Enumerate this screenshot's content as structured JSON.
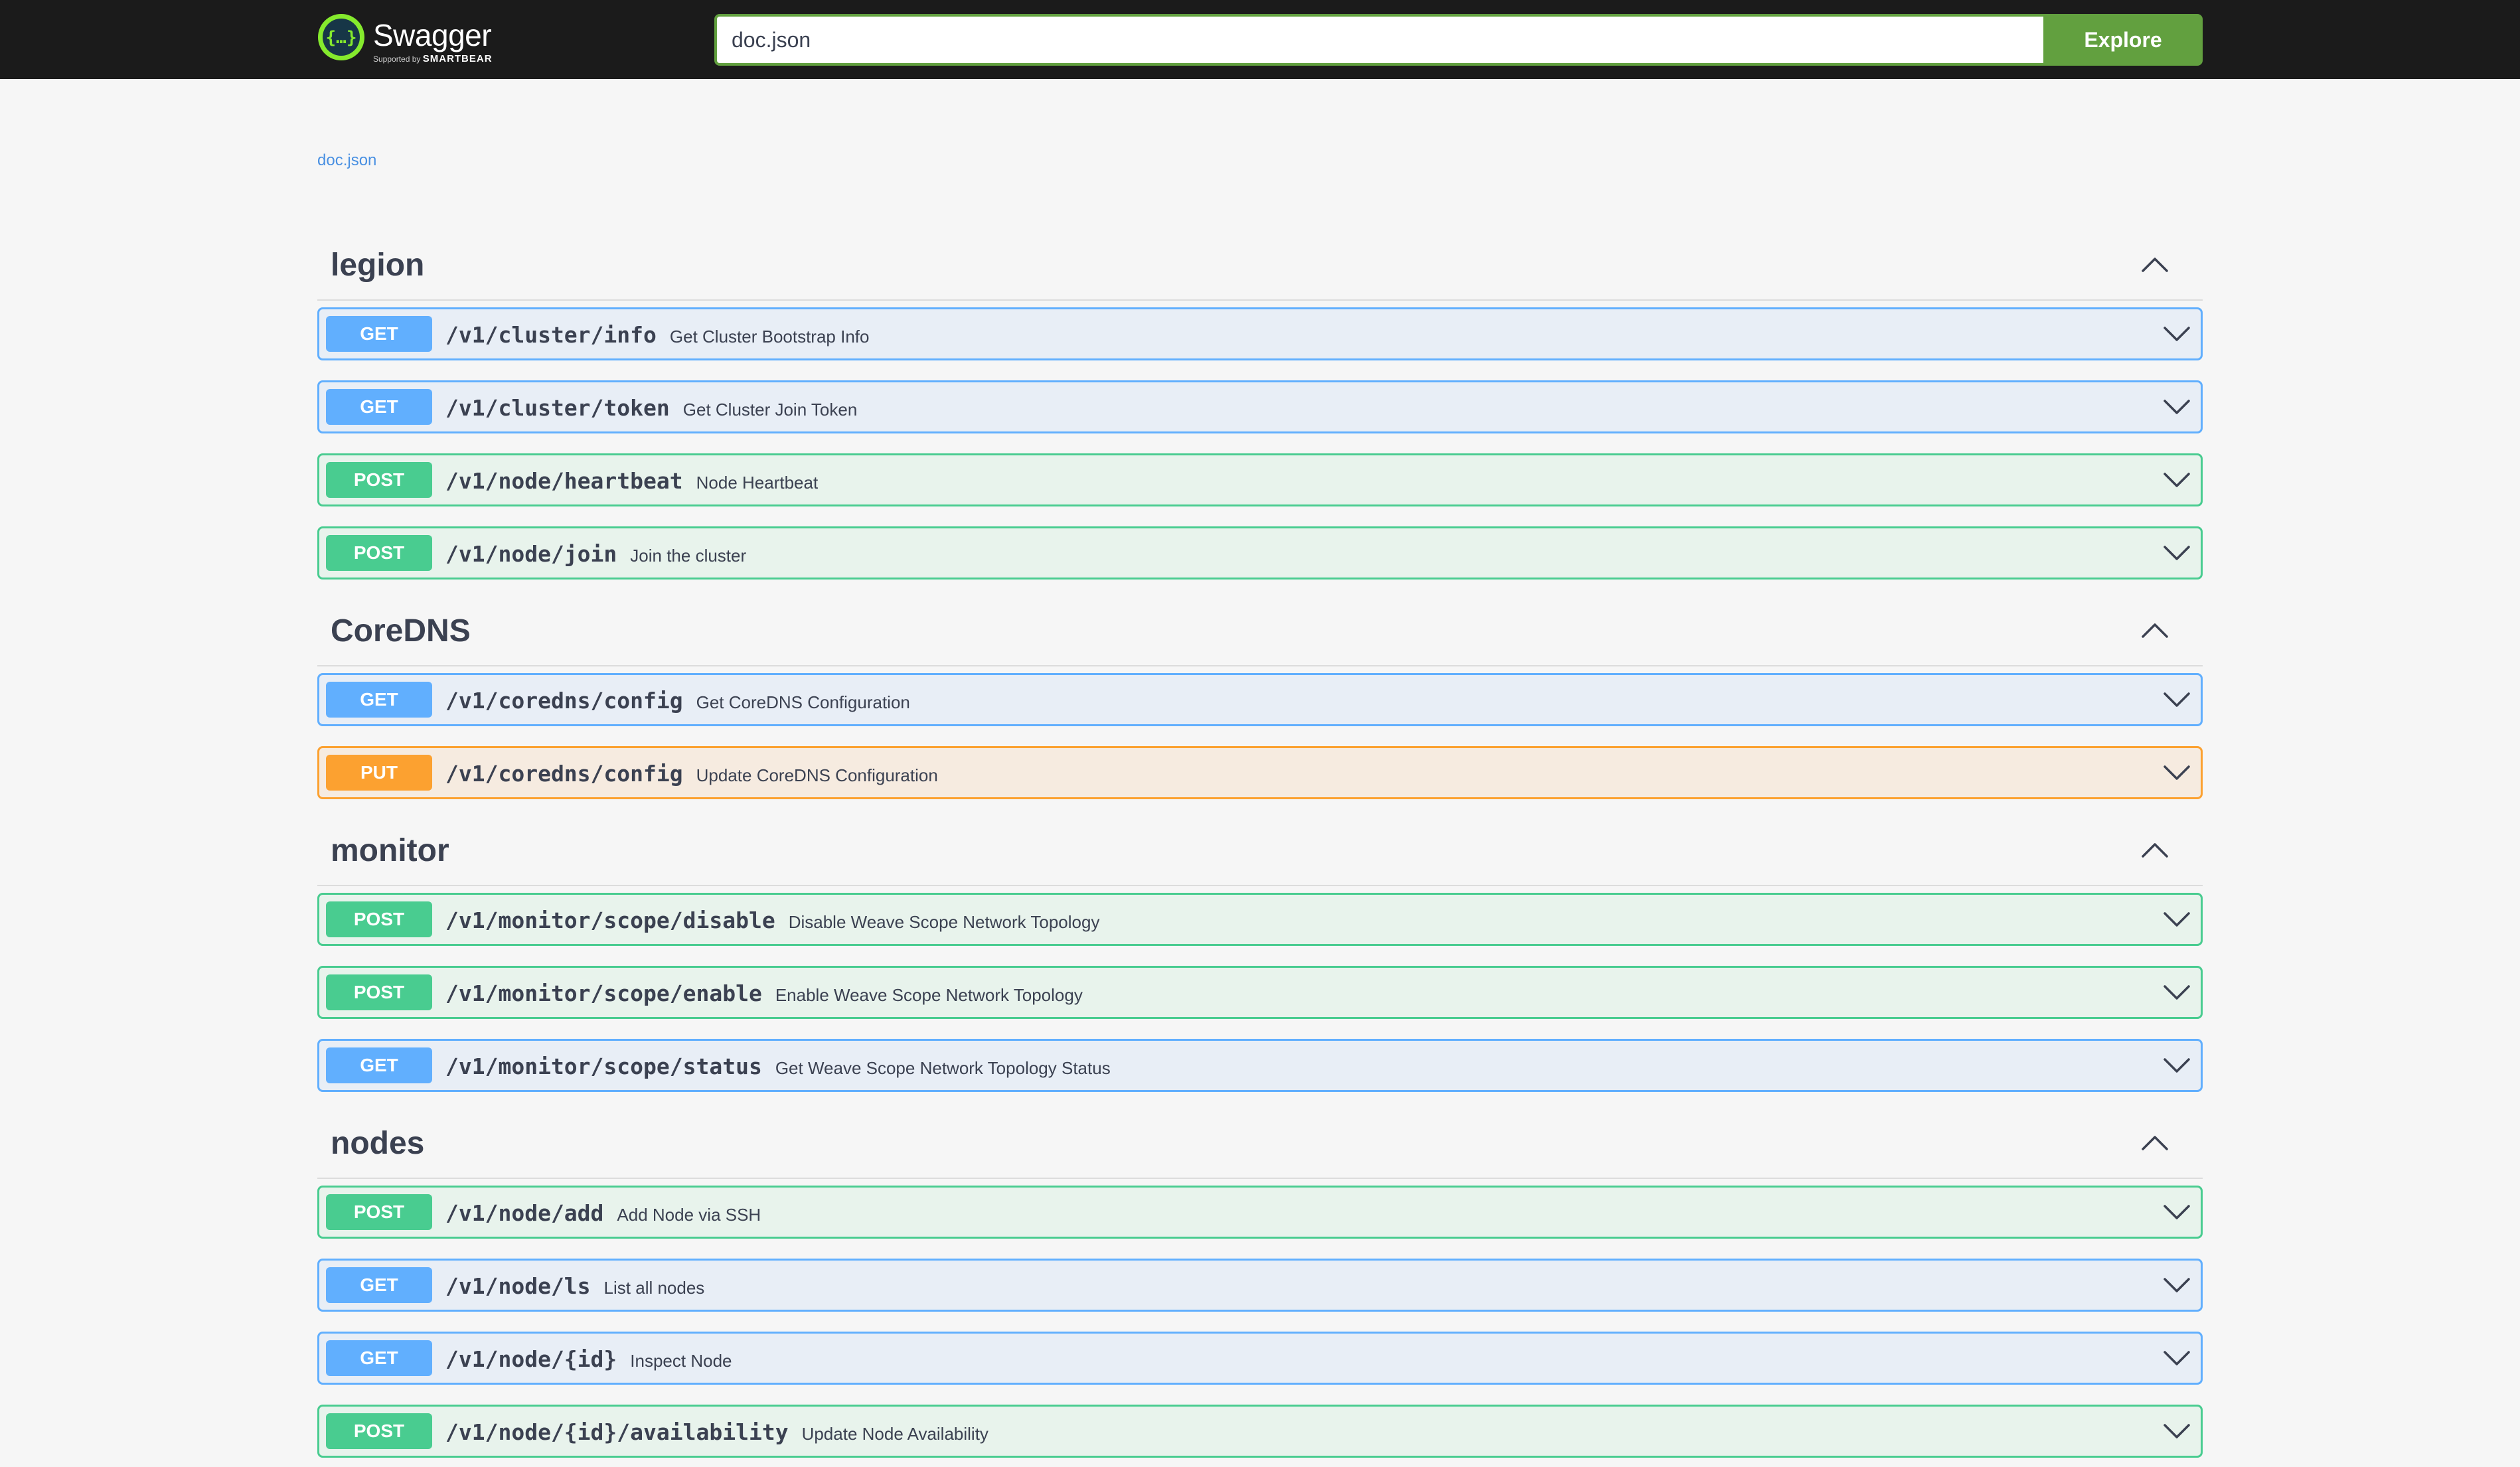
{
  "header": {
    "brand_name": "Swagger",
    "brand_sub_prefix": "Supported by",
    "brand_sub_company": "SMARTBEAR",
    "url_value": "doc.json",
    "explore_label": "Explore"
  },
  "spec_link": "doc.json",
  "colors": {
    "get": "#61affe",
    "post": "#49cc90",
    "put": "#fca130",
    "explore": "#62a03f"
  },
  "icons": {
    "collapse": "chevron-up-icon",
    "expand": "chevron-down-icon",
    "logo": "swagger-logo-icon"
  },
  "tags": [
    {
      "name": "legion",
      "operations": [
        {
          "method": "GET",
          "path": "/v1/cluster/info",
          "summary": "Get Cluster Bootstrap Info"
        },
        {
          "method": "GET",
          "path": "/v1/cluster/token",
          "summary": "Get Cluster Join Token"
        },
        {
          "method": "POST",
          "path": "/v1/node/heartbeat",
          "summary": "Node Heartbeat"
        },
        {
          "method": "POST",
          "path": "/v1/node/join",
          "summary": "Join the cluster"
        }
      ]
    },
    {
      "name": "CoreDNS",
      "operations": [
        {
          "method": "GET",
          "path": "/v1/coredns/config",
          "summary": "Get CoreDNS Configuration"
        },
        {
          "method": "PUT",
          "path": "/v1/coredns/config",
          "summary": "Update CoreDNS Configuration"
        }
      ]
    },
    {
      "name": "monitor",
      "operations": [
        {
          "method": "POST",
          "path": "/v1/monitor/scope/disable",
          "summary": "Disable Weave Scope Network Topology"
        },
        {
          "method": "POST",
          "path": "/v1/monitor/scope/enable",
          "summary": "Enable Weave Scope Network Topology"
        },
        {
          "method": "GET",
          "path": "/v1/monitor/scope/status",
          "summary": "Get Weave Scope Network Topology Status"
        }
      ]
    },
    {
      "name": "nodes",
      "operations": [
        {
          "method": "POST",
          "path": "/v1/node/add",
          "summary": "Add Node via SSH"
        },
        {
          "method": "GET",
          "path": "/v1/node/ls",
          "summary": "List all nodes"
        },
        {
          "method": "GET",
          "path": "/v1/node/{id}",
          "summary": "Inspect Node"
        },
        {
          "method": "POST",
          "path": "/v1/node/{id}/availability",
          "summary": "Update Node Availability"
        }
      ]
    }
  ]
}
